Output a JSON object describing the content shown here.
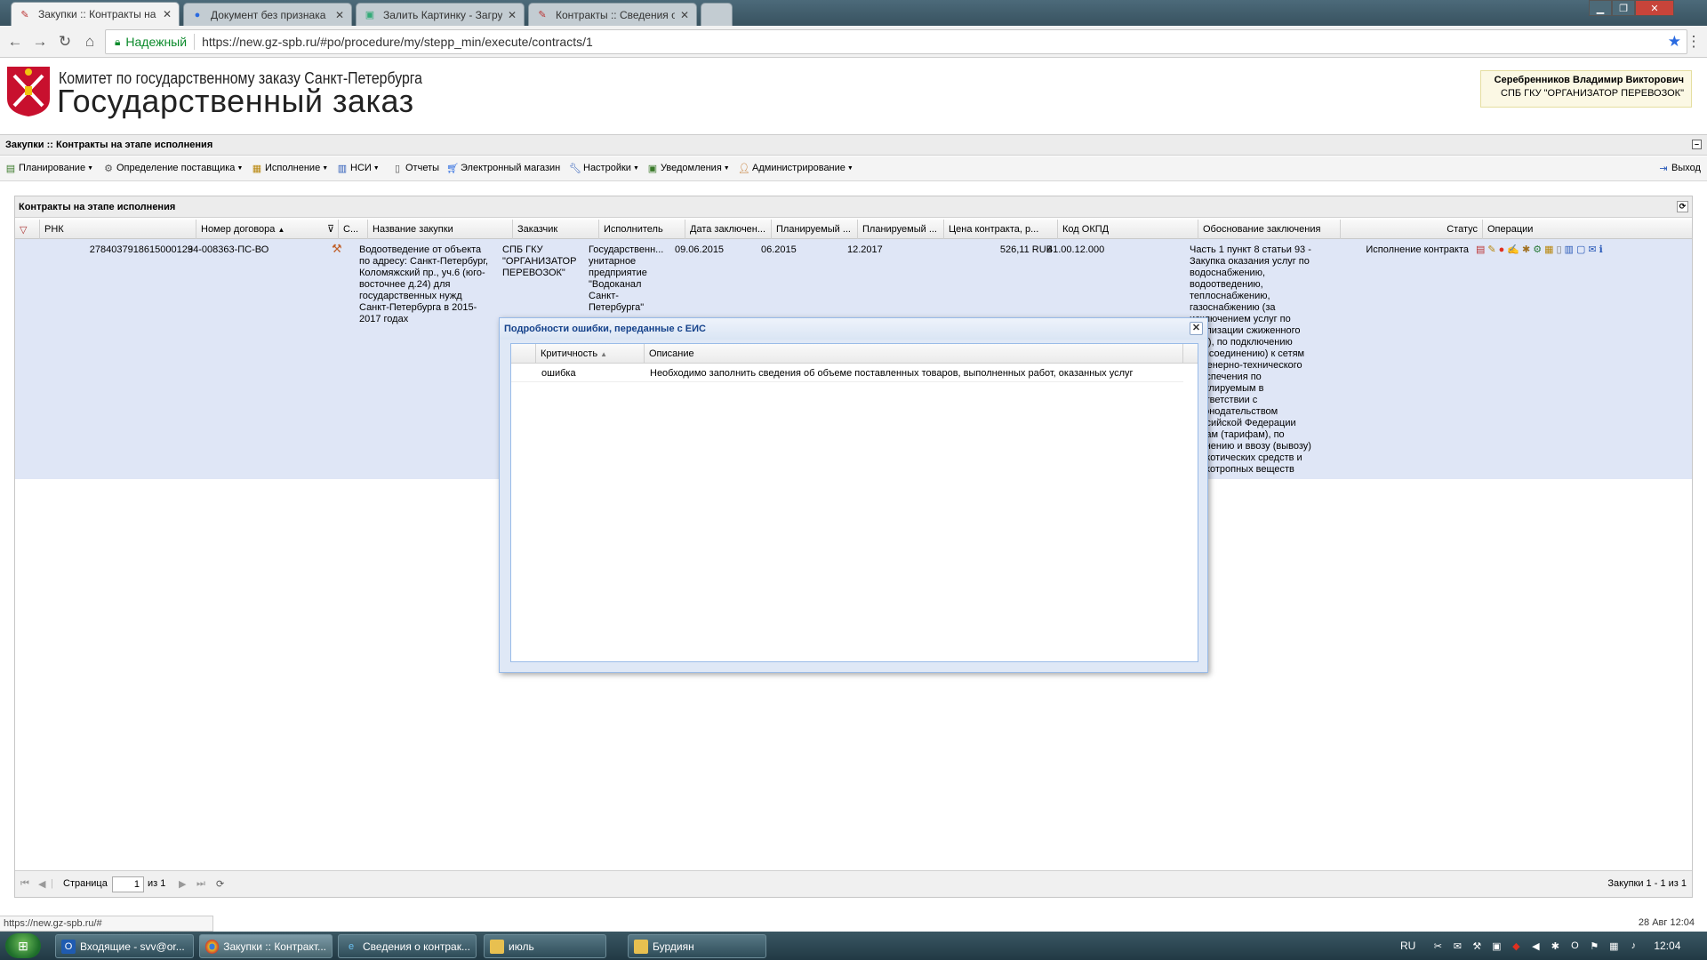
{
  "browser": {
    "tabs": [
      {
        "label": "Закупки :: Контракты на",
        "icon": "document-icon",
        "active": true
      },
      {
        "label": "Документ без признака",
        "icon": "globe-icon",
        "active": false
      },
      {
        "label": "Залить Картинку - Загру",
        "icon": "image-icon",
        "active": false
      },
      {
        "label": "Контракты :: Сведения о",
        "icon": "document-icon",
        "active": false
      }
    ],
    "secure_label": "Надежный",
    "url": "https://new.gz-spb.ru/#po/procedure/my/stepp_min/execute/contracts/1"
  },
  "header": {
    "org_name": "Комитет по государственному заказу Санкт-Петербурга",
    "system_name": "Государственный заказ",
    "user_name": "Серебренников Владимир Викторович",
    "user_org": "СПБ ГКУ \"ОРГАНИЗАТОР ПЕРЕВОЗОК\""
  },
  "panel_title": "Закупки :: Контракты на этапе исполнения",
  "menu": {
    "items": [
      {
        "label": "Планирование",
        "icon": "planning-icon",
        "dropdown": true
      },
      {
        "label": "Определение поставщика",
        "icon": "supplier-icon",
        "dropdown": true
      },
      {
        "label": "Исполнение",
        "icon": "execution-icon",
        "dropdown": true
      },
      {
        "label": "НСИ",
        "icon": "reference-icon",
        "dropdown": true
      },
      {
        "label": "Отчеты",
        "icon": "reports-icon",
        "dropdown": false
      },
      {
        "label": "Электронный магазин",
        "icon": "cart-icon",
        "dropdown": false
      },
      {
        "label": "Настройки",
        "icon": "wrench-icon",
        "dropdown": true
      },
      {
        "label": "Уведомления",
        "icon": "notifications-icon",
        "dropdown": true
      },
      {
        "label": "Администрирование",
        "icon": "admin-icon",
        "dropdown": true
      }
    ],
    "exit_label": "Выход"
  },
  "grid": {
    "title": "Контракты на этапе исполнения",
    "columns": [
      "РНК",
      "Номер договора",
      "С...",
      "Название закупки",
      "Заказчик",
      "Исполнитель",
      "Дата заключен...",
      "Планируемый ...",
      "Планируемый ...",
      "Цена контракта, р...",
      "Код ОКПД",
      "Обоснование заключения",
      "Статус",
      "Операции"
    ],
    "row": {
      "rnk": "2784037918615000129",
      "contract_number": "34-008363-ПС-ВО",
      "purchase_name": "Водоотведение от объекта по адресу: Санкт-Петербург, Коломяжский пр., уч.6 (юго-восточнее д.24) для государственных нужд Санкт-Петербурга в 2015-2017 годах",
      "customer": "СПБ ГКУ \"ОРГАНИЗАТОР ПЕРЕВОЗОК\"",
      "executor": "Государственн... унитарное предприятие \"Водоканал Санкт-Петербурга\"",
      "date_concluded": "09.06.2015",
      "planned_start": "06.2015",
      "planned_end": "12.2017",
      "price": "526,11 RUB",
      "okpd": "41.00.12.000",
      "basis": "Часть 1 пункт 8 статьи 93 - Закупка оказания услуг по водоснабжению, водоотведению, теплоснабжению, газоснабжению (за исключением услуг по реализации сжиженного газа), по подключению (присоединению) к сетям инженерно-технического обеспечения по регулируемым в соответствии с законодательством Российской Федерации ценам (тарифам), по хранению и ввозу (вывозу) наркотических средств и психотропных веществ",
      "status": "Исполнение контракта"
    },
    "footer": {
      "page_label": "Страница",
      "page_value": "1",
      "of_label": "из 1",
      "summary": "Закупки 1 - 1 из 1"
    }
  },
  "modal": {
    "title": "Подробности ошибки, переданные с ЕИС",
    "columns": [
      "Критичность",
      "Описание"
    ],
    "rows": [
      {
        "severity": "ошибка",
        "description": "Необходимо заполнить сведения об объеме поставленных товаров, выполненных работ, оказанных услуг"
      }
    ]
  },
  "status_bar": {
    "url": "https://new.gz-spb.ru/#",
    "datetime": "28 Авг 12:04"
  },
  "taskbar": {
    "items": [
      {
        "label": "Входящие - svv@or...",
        "icon": "outlook-icon"
      },
      {
        "label": "Закупки :: Контракт...",
        "icon": "chrome-icon"
      },
      {
        "label": "Сведения о контрак...",
        "icon": "ie-icon"
      },
      {
        "label": "июль",
        "icon": "folder-icon"
      },
      {
        "label": "Бурдиян",
        "icon": "folder-icon"
      }
    ],
    "lang": "RU",
    "clock": "12:04"
  },
  "colors": {
    "selected_row": "#dfe6f6",
    "modal_border": "#99bbe8",
    "secure_green": "#0a8a2a"
  }
}
